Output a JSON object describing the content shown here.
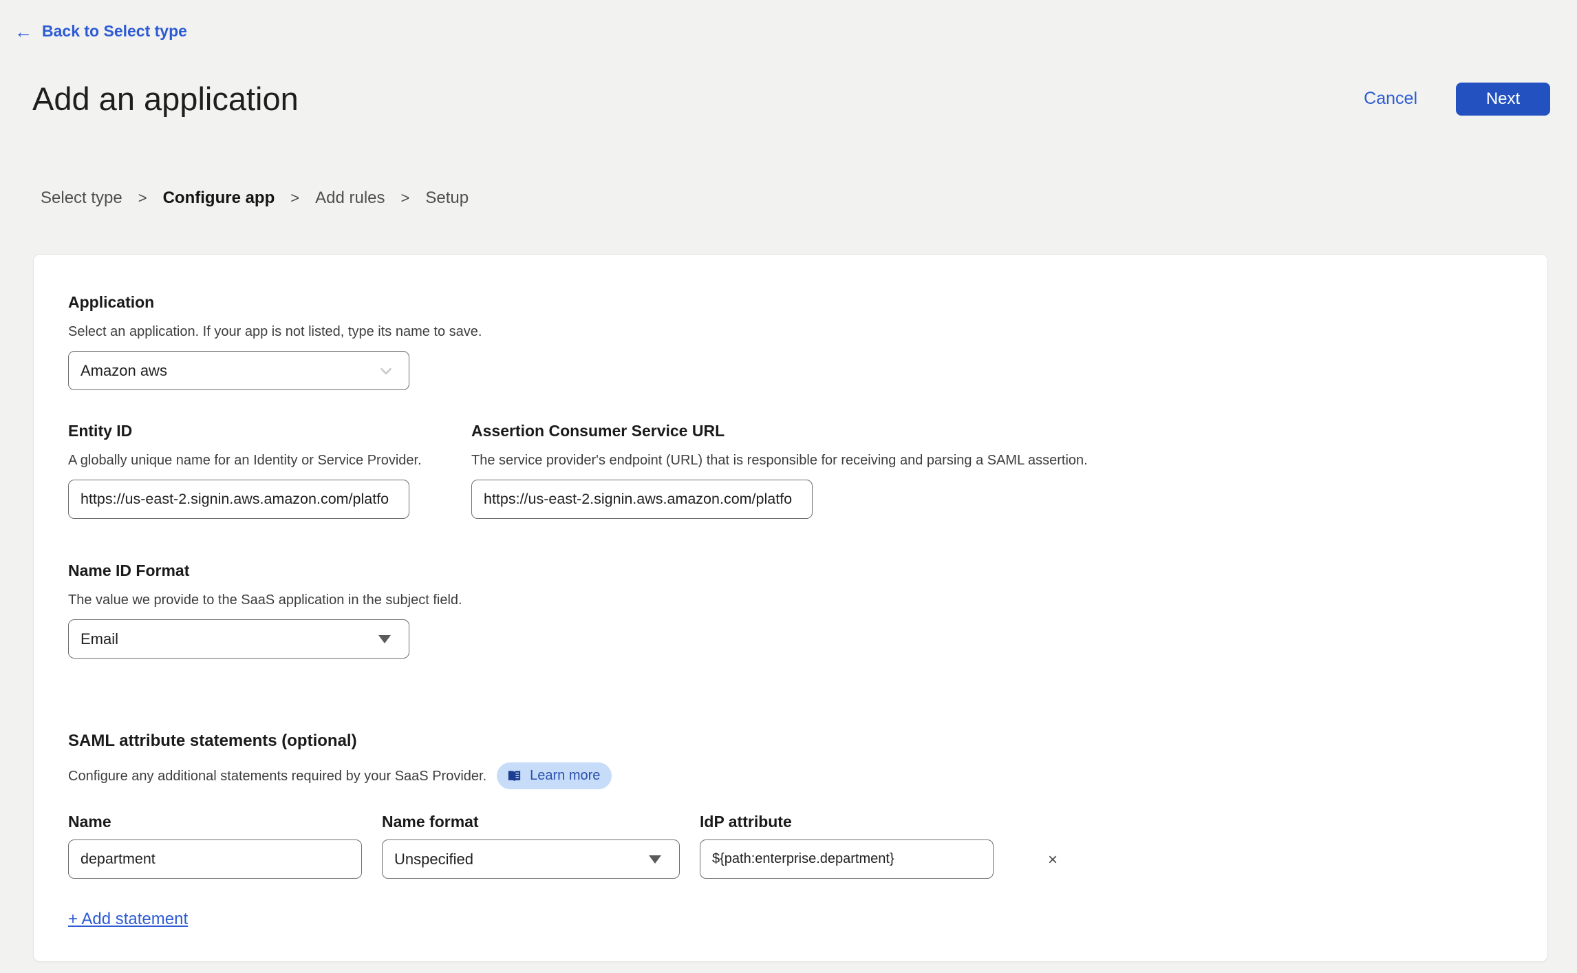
{
  "header": {
    "back": {
      "arrow": "←",
      "label": "Back to Select type"
    },
    "title": "Add an application",
    "cancel_label": "Cancel",
    "next_label": "Next"
  },
  "breadcrumb": {
    "separator": ">",
    "steps": [
      {
        "label": "Select type",
        "current": false
      },
      {
        "label": "Configure app",
        "current": true
      },
      {
        "label": "Add rules",
        "current": false
      },
      {
        "label": "Setup",
        "current": false
      }
    ]
  },
  "form": {
    "application": {
      "label": "Application",
      "description": "Select an application. If your app is not listed, type its name to save.",
      "value": "Amazon aws",
      "chevron_icon": "chevron-down"
    },
    "entity_id": {
      "label": "Entity ID",
      "description": "A globally unique name for an Identity or Service Provider.",
      "value": "https://us-east-2.signin.aws.amazon.com/platfo"
    },
    "acs_url": {
      "label": "Assertion Consumer Service URL",
      "description": "The service provider's endpoint (URL) that is responsible for receiving and parsing a SAML assertion.",
      "value": "https://us-east-2.signin.aws.amazon.com/platfo"
    },
    "name_id_format": {
      "label": "Name ID Format",
      "description": "The value we provide to the SaaS application in the subject field.",
      "value": "Email"
    },
    "saml_attributes": {
      "label": "SAML attribute statements (optional)",
      "description": "Configure any additional statements required by your SaaS Provider.",
      "learn_more_label": "Learn more",
      "columns": {
        "name": "Name",
        "name_format": "Name format",
        "idp_attribute": "IdP attribute"
      },
      "statements": [
        {
          "name": "department",
          "name_format": "Unspecified",
          "idp_attribute": "${path:enterprise.department}",
          "remove_label": "×"
        }
      ],
      "add_statement_label": "+ Add statement"
    }
  },
  "colors": {
    "link_blue": "#2d5bd3",
    "button_blue": "#2352c0",
    "pill_bg": "#c6dcf8",
    "pill_text": "#2b4fae",
    "pill_icon": "#1c3d8f"
  }
}
